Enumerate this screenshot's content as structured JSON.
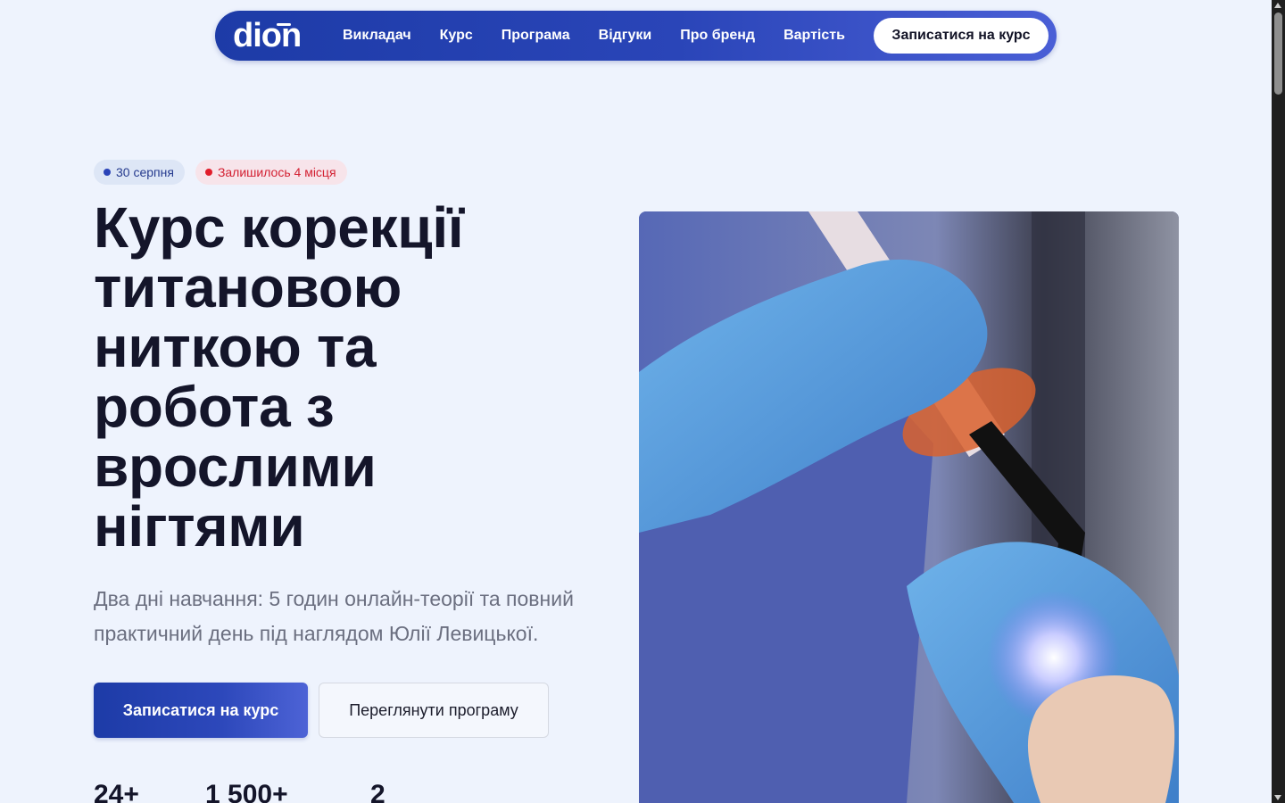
{
  "nav": {
    "logo_text": "dion",
    "links": [
      "Викладач",
      "Курс",
      "Програма",
      "Відгуки",
      "Про бренд",
      "Вартість"
    ],
    "cta_label": "Записатися на курс"
  },
  "hero": {
    "badges": {
      "date": "30 серпня",
      "seats": "Залишилось 4 місця"
    },
    "title_lines": [
      "Курс корекції",
      "титановою",
      "ниткою та",
      "робота з",
      "врослими",
      "нігтями"
    ],
    "subtitle": "Два дні навчання: 5 годин онлайн-теорії та повний практичний день під наглядом Юлії Левицької.",
    "primary_button": "Записатися на курс",
    "secondary_button": "Переглянути програму",
    "stats": [
      "24+",
      "1 500+",
      "2"
    ],
    "image_icon": "photo-gloved-hands-uv-lamp"
  },
  "colors": {
    "accent": "#1d3ba7",
    "page_bg": "#eef3fd",
    "seats_red": "#d32032"
  }
}
